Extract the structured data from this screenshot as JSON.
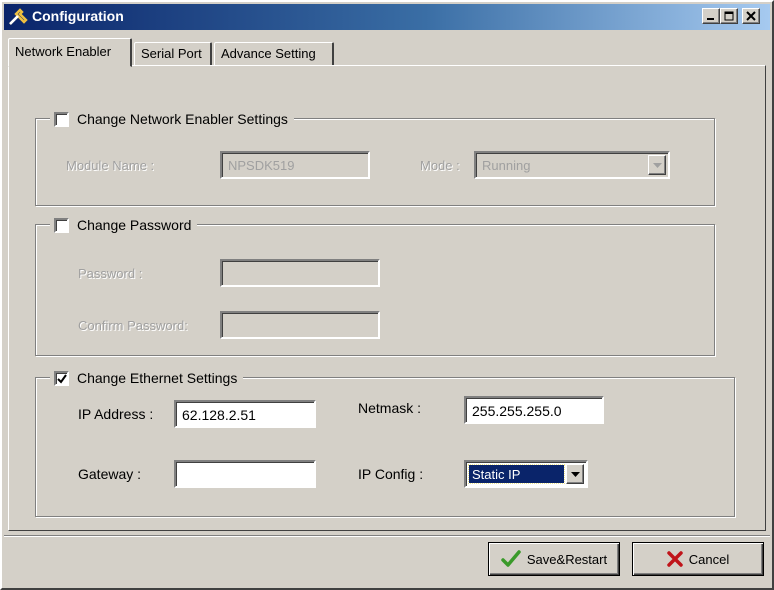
{
  "window": {
    "title": "Configuration",
    "caption_buttons": [
      {
        "name": "minimize",
        "icon": "minimize-icon"
      },
      {
        "name": "maximize",
        "icon": "maximize-icon"
      },
      {
        "name": "close",
        "icon": "close-icon"
      }
    ]
  },
  "tabs": [
    {
      "label": "Network Enabler",
      "active": true
    },
    {
      "label": "Serial Port",
      "active": false
    },
    {
      "label": "Advance Setting",
      "active": false
    }
  ],
  "network_enabler_group": {
    "checkbox_label": "Change Network Enabler Settings",
    "checked": false,
    "module_name_label": "Module Name :",
    "module_name_value": "NPSDK519",
    "mode_label": "Mode :",
    "mode_value": "Running"
  },
  "password_group": {
    "checkbox_label": "Change Password",
    "checked": false,
    "password_label": "Password :",
    "password_value": "",
    "confirm_label": "Confirm Password:",
    "confirm_value": ""
  },
  "ethernet_group": {
    "checkbox_label": "Change Ethernet Settings",
    "checked": true,
    "ip_label": "IP Address :",
    "ip_value": "62.128.2.51",
    "netmask_label": "Netmask :",
    "netmask_value": "255.255.255.0",
    "gateway_label": "Gateway :",
    "gateway_value": "",
    "ipconfig_label": "IP Config :",
    "ipconfig_value": "Static IP"
  },
  "buttons": {
    "save_restart": "Save&Restart",
    "cancel": "Cancel"
  },
  "colors": {
    "titlebar_start": "#0a246a",
    "titlebar_end": "#a6caf0",
    "face": "#d4d0c8",
    "selection": "#0a246a",
    "check_green": "#3a9a2a",
    "cancel_red": "#c0141a"
  }
}
